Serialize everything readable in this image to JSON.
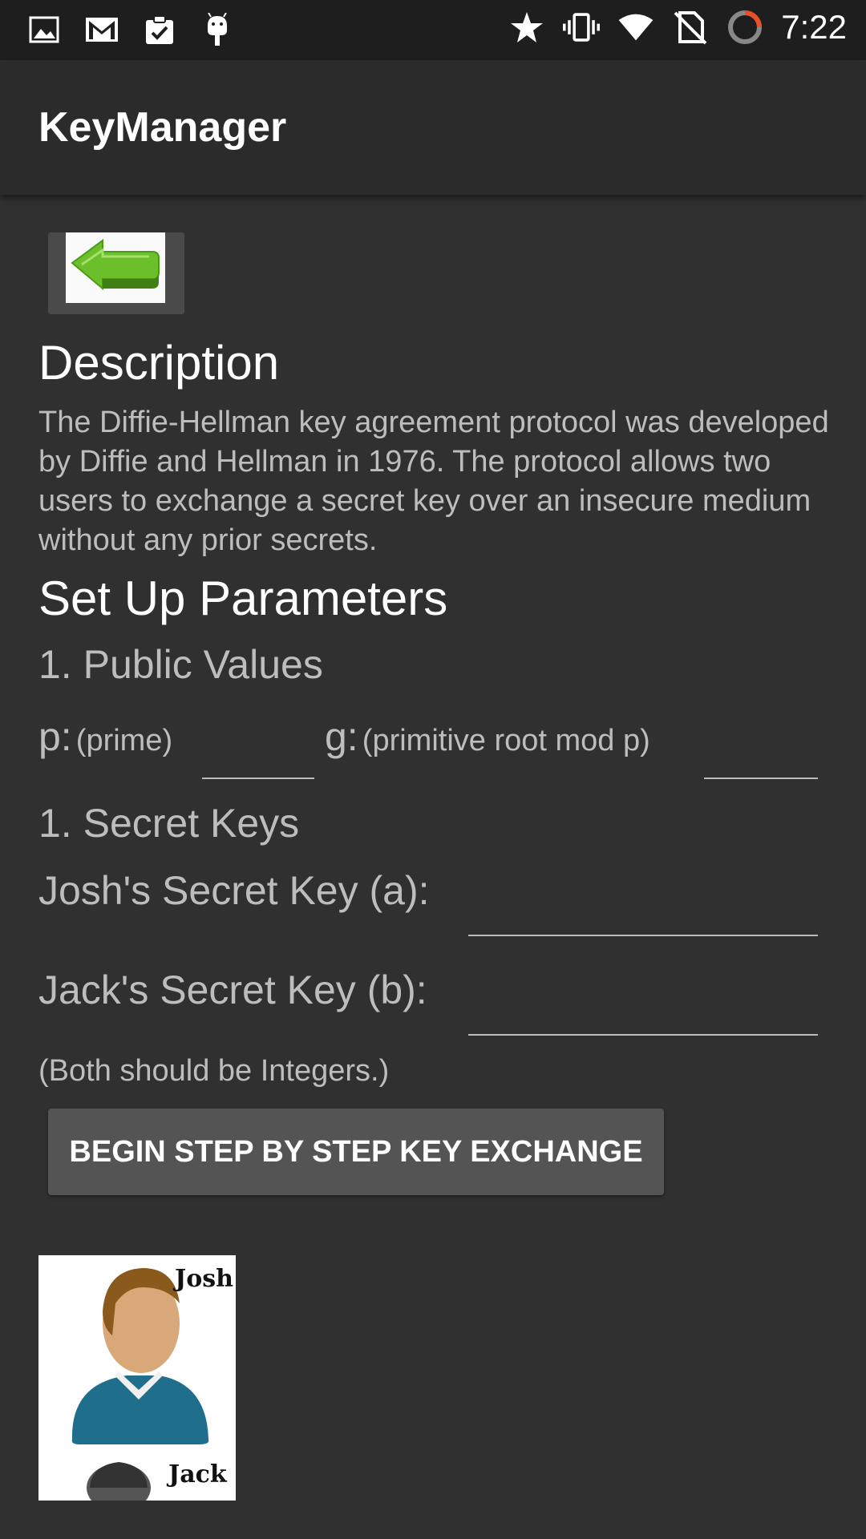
{
  "status_bar": {
    "time": "7:22",
    "left_icons": [
      "image-icon",
      "gmail-icon",
      "clipboard-check-icon",
      "android-icon"
    ],
    "right_icons": [
      "star-icon",
      "vibrate-icon",
      "wifi-icon",
      "no-sim-icon",
      "loading-icon"
    ]
  },
  "app_bar": {
    "title": "KeyManager"
  },
  "back_button": {
    "icon": "green-back-arrow-icon"
  },
  "description": {
    "heading": "Description",
    "body": "The Diffie-Hellman key agreement protocol was developed by Diffie and Hellman in 1976. The protocol allows two users to exchange a secret key over an insecure medium without any prior secrets."
  },
  "setup": {
    "heading": "Set Up Parameters",
    "public_values": {
      "heading": "1. Public Values",
      "p_label": "p:",
      "p_hint": "(prime)",
      "p_value": "",
      "g_label": "g:",
      "g_hint": "(primitive root mod p)",
      "g_value": ""
    },
    "secret_keys": {
      "heading": "1. Secret Keys",
      "josh_label": "Josh's Secret Key (a):",
      "josh_value": "",
      "jack_label": "Jack's Secret Key (b):",
      "jack_value": ""
    },
    "hint": "(Both should be Integers.)",
    "begin_button": "BEGIN STEP BY STEP KEY EXCHANGE"
  },
  "avatars": {
    "josh_name": "Josh",
    "jack_name": "Jack"
  },
  "colors": {
    "background": "#303030",
    "app_bar": "#2b2b2b",
    "status_bar": "#1e1e1e",
    "button": "#545454",
    "arrow_green": "#6bbf2a"
  }
}
